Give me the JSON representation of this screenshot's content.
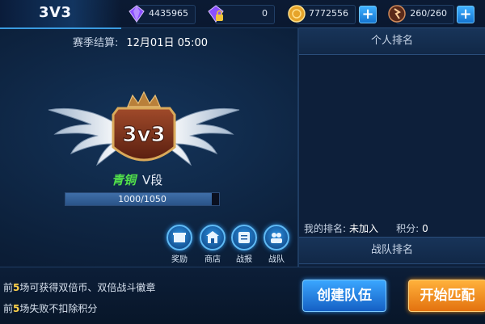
{
  "header": {
    "mode_title": "3V3",
    "resources": [
      {
        "name": "diamond",
        "value": "4435965",
        "icon": "purple-diamond-icon",
        "color": "#8a4fff",
        "has_plus": false
      },
      {
        "name": "locked-diamond",
        "value": "0",
        "icon": "locked-diamond-icon",
        "color": "#8a4fff",
        "has_plus": false
      },
      {
        "name": "gold",
        "value": "7772556",
        "icon": "gold-coin-icon",
        "color": "#e6a42a",
        "has_plus": true
      },
      {
        "name": "stamina",
        "value": "260/260",
        "icon": "stamina-icon",
        "color": "#b8623a",
        "has_plus": true
      }
    ],
    "plus_label": "+"
  },
  "season": {
    "label": "赛季结算:",
    "value": "12月01日 05:00"
  },
  "rank": {
    "emblem_text": "3v3",
    "tier": "青铜",
    "division": "V段",
    "progress_text": "1000/1050",
    "progress_fraction": 0.952
  },
  "tools": [
    {
      "label": "奖励",
      "icon": "reward-icon"
    },
    {
      "label": "商店",
      "icon": "shop-icon"
    },
    {
      "label": "战报",
      "icon": "battle-report-icon"
    },
    {
      "label": "战队",
      "icon": "team-icon"
    }
  ],
  "right_panel": {
    "personal_ranking": "个人排名",
    "my_rank_label": "我的排名:",
    "my_rank_value": "未加入",
    "points_label": "积分:",
    "points_value": "0",
    "team_ranking": "战队排名"
  },
  "tips": [
    {
      "prefix": "前",
      "bold": "5",
      "text": "场可获得双倍币、双倍战斗徽章"
    },
    {
      "prefix": "前",
      "bold": "5",
      "text": "场失败不扣除积分"
    }
  ],
  "buttons": {
    "create_team": "创建队伍",
    "start_match": "开始匹配"
  },
  "colors": {
    "tier_bronze_green": "#52e04a",
    "accent_blue": "#3a9be0",
    "match_orange": "#f09a24"
  }
}
